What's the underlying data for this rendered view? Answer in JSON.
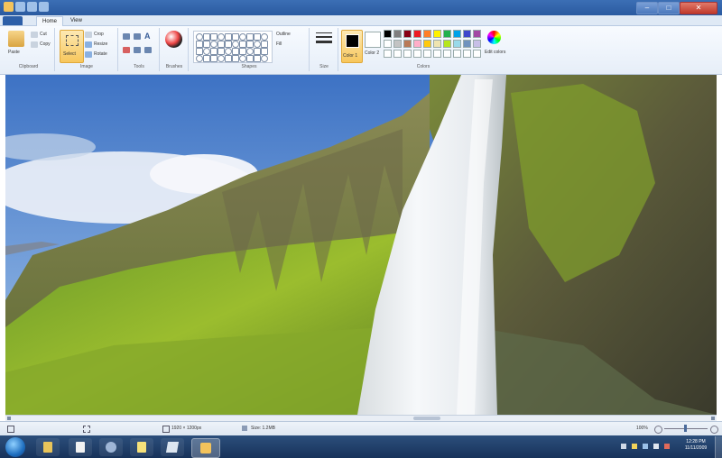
{
  "window": {
    "title": "",
    "minimize": "–",
    "maximize": "□",
    "close": "✕"
  },
  "tabs": {
    "file": "",
    "home": "Home",
    "view": "View"
  },
  "ribbon": {
    "clipboard": {
      "label": "Clipboard",
      "paste": "Paste",
      "cut": "Cut",
      "copy": "Copy"
    },
    "image": {
      "label": "Image",
      "select": "Select",
      "crop": "Crop",
      "resize": "Resize",
      "rotate": "Rotate"
    },
    "tools": {
      "label": "Tools"
    },
    "brushes": {
      "label": "Brushes"
    },
    "shapes": {
      "label": "Shapes",
      "outline": "Outline",
      "fill": "Fill"
    },
    "size": {
      "label": "Size"
    },
    "colors": {
      "label": "Colors",
      "color1": "Color 1",
      "color2": "Color 2",
      "edit_colors": "Edit colors"
    }
  },
  "palette": {
    "row1": [
      "#000000",
      "#7f7f7f",
      "#880015",
      "#ed1c24",
      "#ff7f27",
      "#fff200",
      "#22b14c",
      "#00a2e8",
      "#3f48cc",
      "#a349a4"
    ],
    "row2": [
      "#ffffff",
      "#c3c3c3",
      "#b97a57",
      "#ffaec9",
      "#ffc90e",
      "#efe4b0",
      "#b5e61d",
      "#99d9ea",
      "#7092be",
      "#c8bfe7"
    ],
    "row3": [
      "#ffffff",
      "#ffffff",
      "#ffffff",
      "#ffffff",
      "#ffffff",
      "#ffffff",
      "#ffffff",
      "#ffffff",
      "#ffffff",
      "#ffffff"
    ]
  },
  "statusbar": {
    "dimensions": "1920 × 1200px",
    "size": "Size: 1.2MB",
    "zoom": "100%"
  },
  "tray": {
    "time": "12:28 PM",
    "date": "11/11/2009"
  }
}
